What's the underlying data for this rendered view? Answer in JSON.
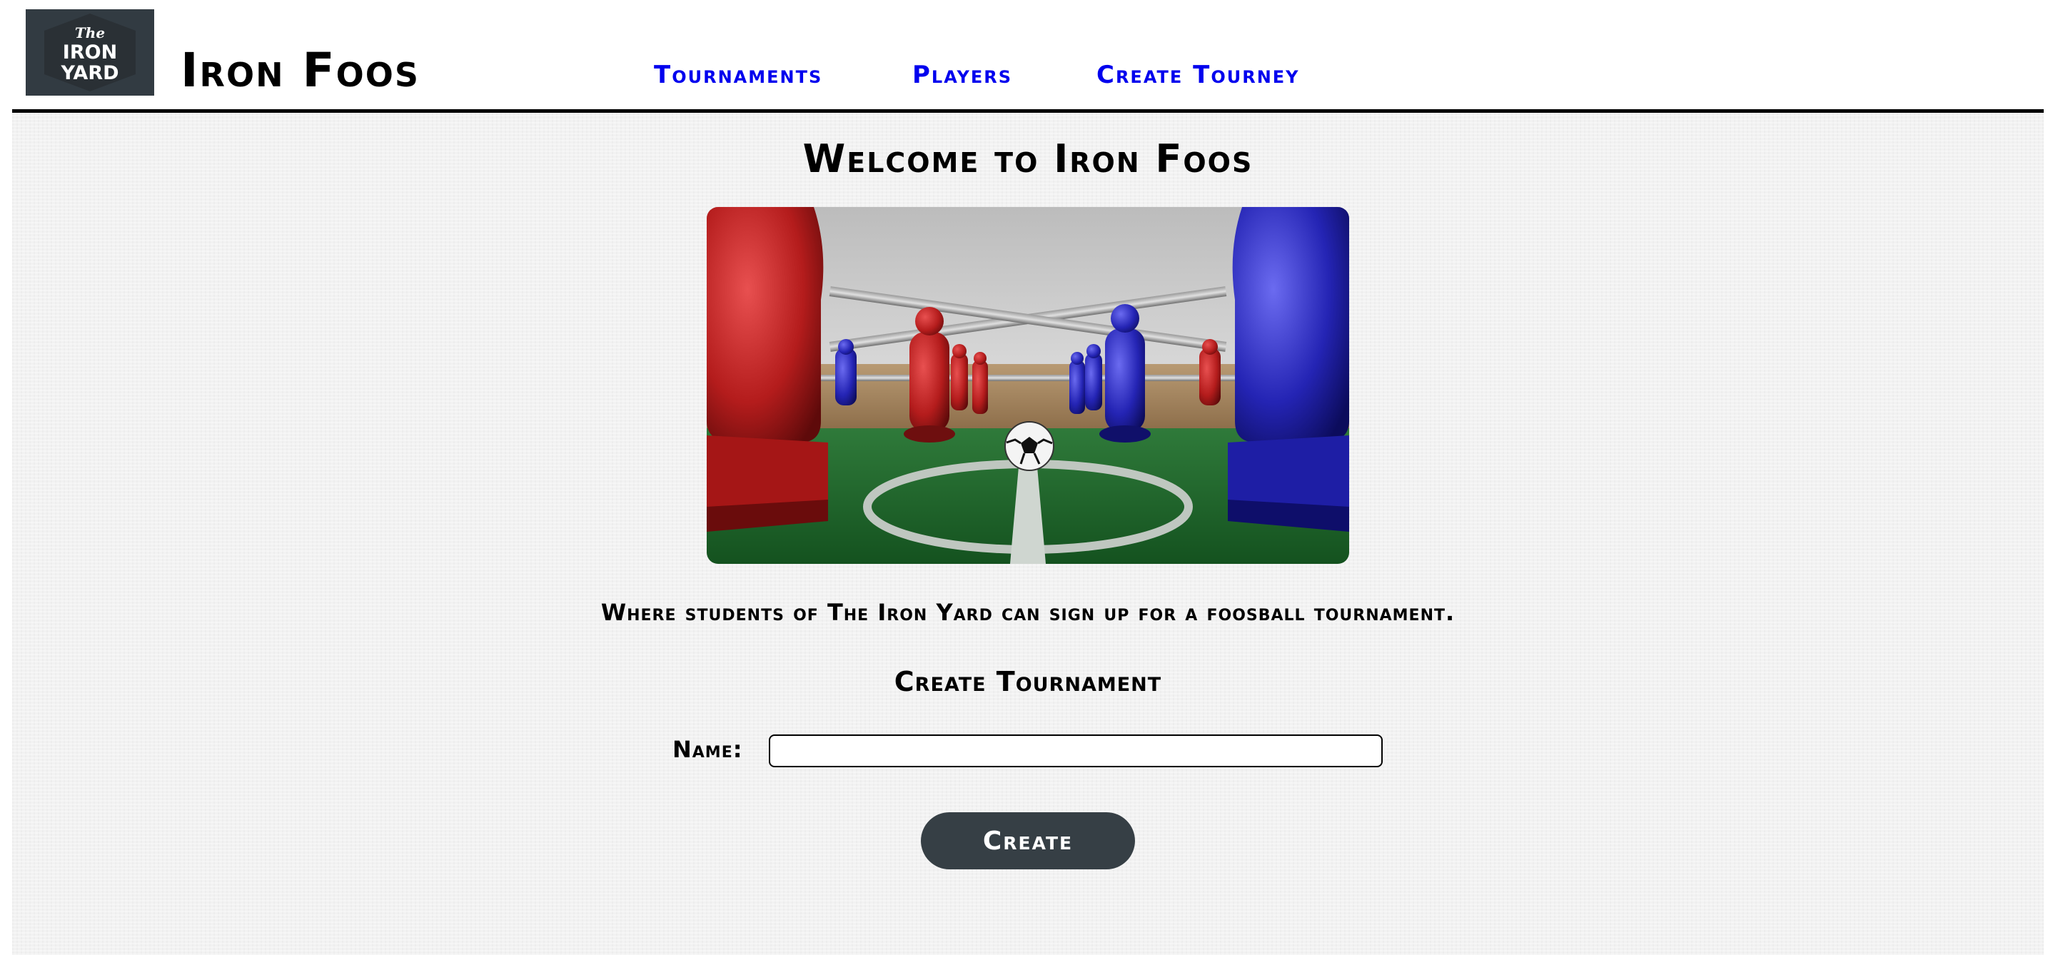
{
  "header": {
    "logo": {
      "lines": [
        "The",
        "IRON",
        "YARD"
      ],
      "background": "#323b42"
    },
    "site_title": "Iron Foos",
    "nav": [
      {
        "label": "Tournaments"
      },
      {
        "label": "Players"
      },
      {
        "label": "Create Tourney"
      }
    ],
    "link_color": "#0000ee"
  },
  "main": {
    "welcome": "Welcome to Iron Foos",
    "hero_image": {
      "subject": "foosball table with red and blue players and a soccer ball"
    },
    "tagline": "Where students of The Iron Yard can sign up for a foosball tournament.",
    "form": {
      "title": "Create Tournament",
      "name_label": "Name:",
      "name_value": "",
      "name_placeholder": "",
      "submit_label": "Create",
      "button_color": "#363f45"
    }
  }
}
